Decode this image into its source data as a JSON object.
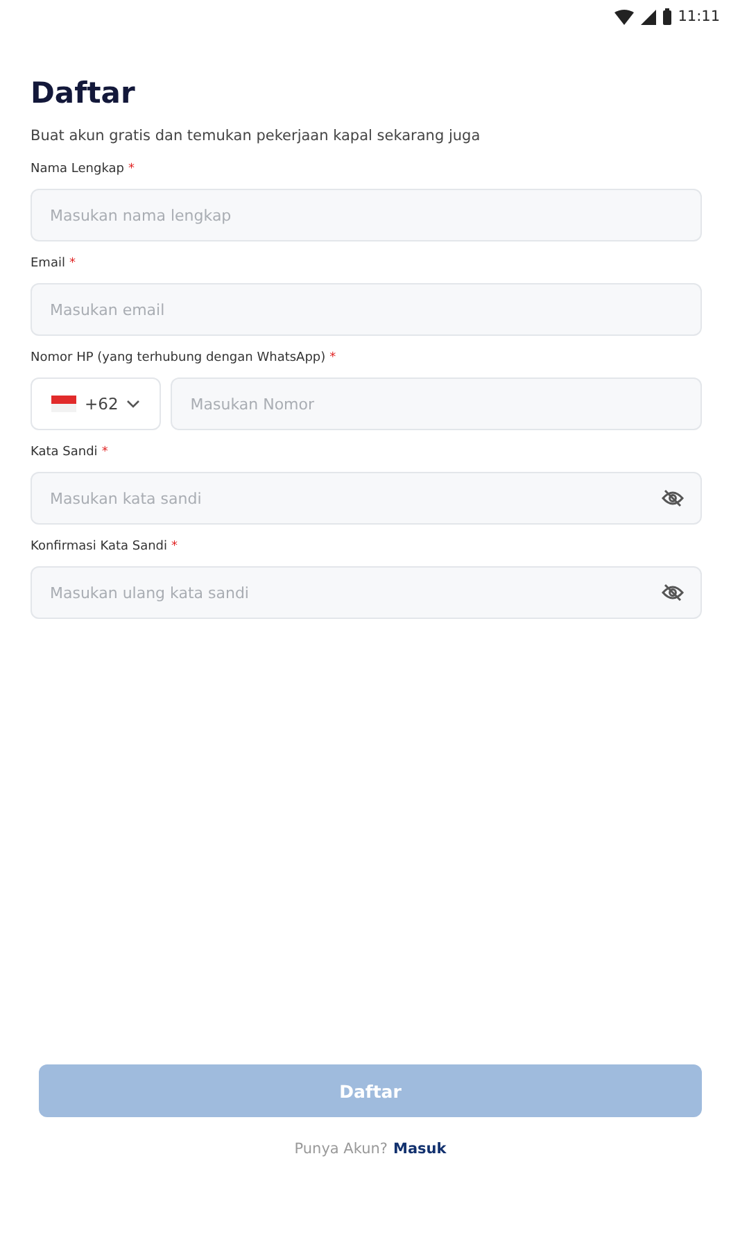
{
  "status_bar": {
    "time": "11:11"
  },
  "header": {
    "title": "Daftar",
    "subtitle": "Buat akun gratis dan temukan pekerjaan kapal sekarang juga"
  },
  "fields": [
    {
      "kind": "text",
      "label": "Nama Lengkap",
      "required_mark": "*",
      "placeholder": "Masukan nama lengkap"
    },
    {
      "kind": "text",
      "label": "Email",
      "required_mark": "*",
      "placeholder": "Masukan email"
    },
    {
      "kind": "phone",
      "label": "Nomor HP (yang terhubung dengan WhatsApp)",
      "required_mark": "*",
      "country_code": "+62",
      "placeholder": "Masukan Nomor"
    },
    {
      "kind": "password",
      "label": "Kata Sandi",
      "required_mark": "*",
      "placeholder": "Masukan kata sandi"
    },
    {
      "kind": "password",
      "label": "Konfirmasi Kata Sandi",
      "required_mark": "*",
      "placeholder": "Masukan ulang kata sandi"
    }
  ],
  "submit_button": {
    "label": "Daftar",
    "disabled": true
  },
  "login_prompt": {
    "text": "Punya Akun?",
    "link": "Masuk"
  }
}
